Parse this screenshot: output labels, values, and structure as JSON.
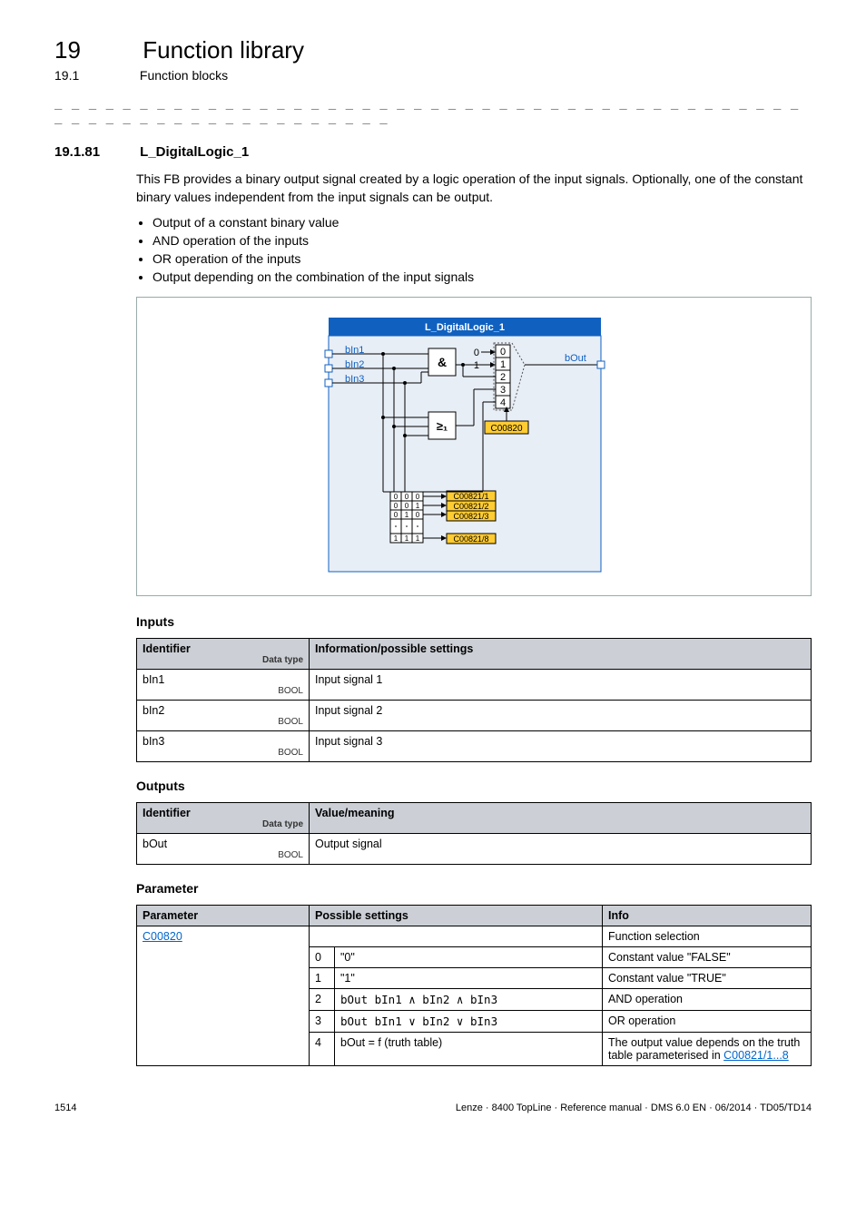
{
  "header": {
    "chapter_number": "19",
    "chapter_title": "Function library",
    "section_number": "19.1",
    "section_title": "Function blocks"
  },
  "dashes": "_ _ _ _ _ _ _ _ _ _ _ _ _ _ _ _ _ _ _ _ _ _ _ _ _ _ _ _ _ _ _ _ _ _ _ _ _ _ _ _ _ _ _ _ _ _ _ _ _ _ _ _ _ _ _ _ _ _ _ _ _ _ _ _",
  "section": {
    "number": "19.1.81",
    "title": "L_DigitalLogic_1",
    "intro": "This FB provides a binary output signal created by a logic operation of the input signals. Optionally, one of the constant binary values independent from the input signals can be output.",
    "bullets": [
      "Output of a constant binary value",
      "AND operation of the inputs",
      "OR operation of the inputs",
      "Output depending on the combination of the input signals"
    ]
  },
  "diagram": {
    "title": "L_DigitalLogic_1",
    "inputs": [
      "bIn1",
      "bIn2",
      "bIn3"
    ],
    "output": "bOut",
    "and_label": "&",
    "or_label": "≥₁",
    "mux_in0": "0",
    "mux_in1": "1",
    "mux_outs": [
      "0",
      "1",
      "2",
      "3",
      "4"
    ],
    "sel_code": "C00820",
    "truth_codes": [
      "C00821/1",
      "C00821/2",
      "C00821/3",
      "C00821/8"
    ],
    "truth_rows": [
      [
        "0",
        "0",
        "0"
      ],
      [
        "0",
        "0",
        "1"
      ],
      [
        "0",
        "1",
        "0"
      ],
      [
        "1",
        "1",
        "1"
      ]
    ]
  },
  "inputs_table": {
    "head": "Inputs",
    "col1": "Identifier",
    "dtype": "Data type",
    "col2": "Information/possible settings",
    "rows": [
      {
        "id": "bIn1",
        "type": "BOOL",
        "info": "Input signal 1"
      },
      {
        "id": "bIn2",
        "type": "BOOL",
        "info": "Input signal 2"
      },
      {
        "id": "bIn3",
        "type": "BOOL",
        "info": "Input signal 3"
      }
    ]
  },
  "outputs_table": {
    "head": "Outputs",
    "col1": "Identifier",
    "dtype": "Data type",
    "col2": "Value/meaning",
    "rows": [
      {
        "id": "bOut",
        "type": "BOOL",
        "info": "Output signal"
      }
    ]
  },
  "param_table": {
    "head": "Parameter",
    "col1": "Parameter",
    "col2": "Possible settings",
    "col3": "Info",
    "param_code": "C00820",
    "info_top": "Function selection",
    "rows": [
      {
        "n": "0",
        "setting": "\"0\"",
        "info": "Constant value \"FALSE\""
      },
      {
        "n": "1",
        "setting": "\"1\"",
        "info": "Constant value \"TRUE\""
      },
      {
        "n": "2",
        "setting": "bOut   bIn1 ∧ bIn2 ∧ bIn3",
        "info": "AND operation"
      },
      {
        "n": "3",
        "setting": "bOut   bIn1 ∨ bIn2 ∨ bIn3",
        "info": "OR operation"
      },
      {
        "n": "4",
        "setting": "bOut = f (truth table)",
        "info_pre": "The output value depends on the truth table parameterised in ",
        "info_link": "C00821/1...8"
      }
    ]
  },
  "footer": {
    "page": "1514",
    "right": "Lenze · 8400 TopLine · Reference manual · DMS 6.0 EN · 06/2014 · TD05/TD14"
  }
}
